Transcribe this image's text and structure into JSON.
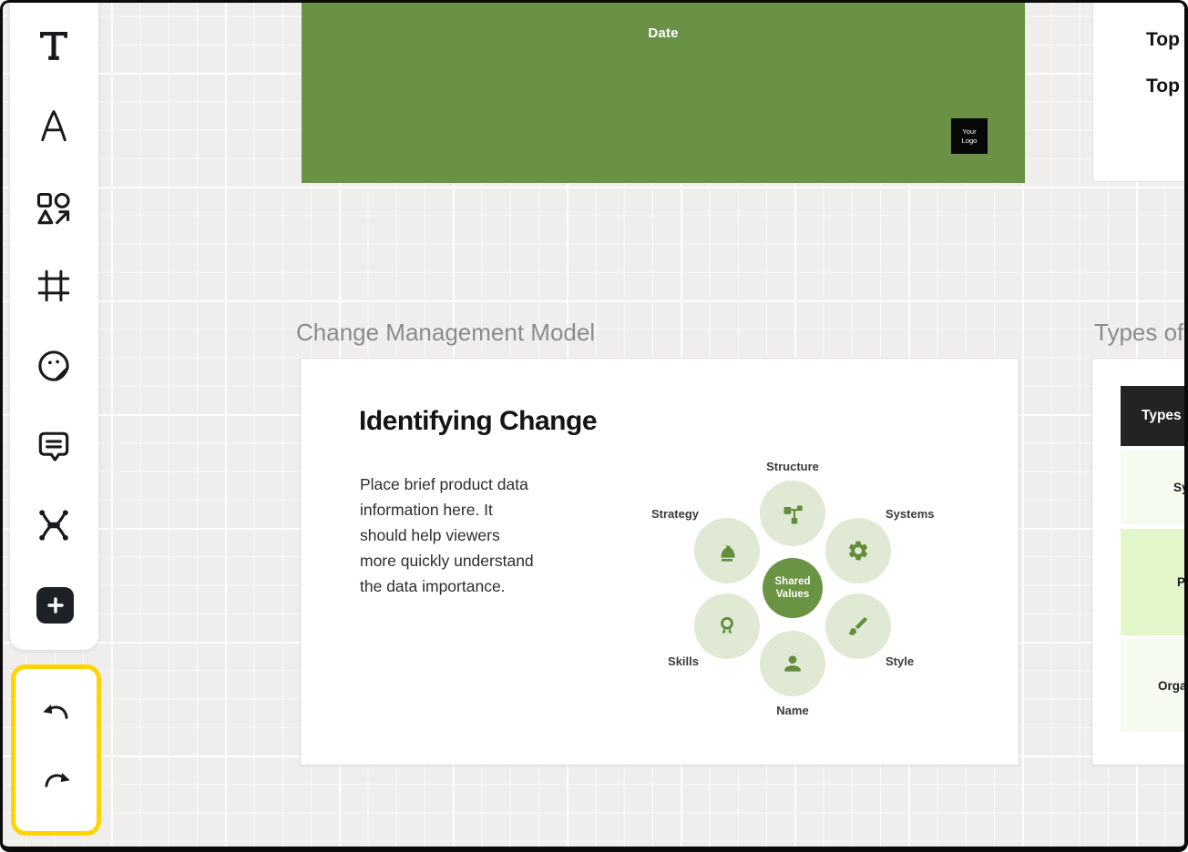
{
  "toolbar": {
    "tools": [
      {
        "name": "text-tool",
        "icon": "text-icon"
      },
      {
        "name": "lettering-tool",
        "icon": "letter-a-icon"
      },
      {
        "name": "shapes-tool",
        "icon": "shapes-icon"
      },
      {
        "name": "frame-tool",
        "icon": "frame-icon"
      },
      {
        "name": "sticker-tool",
        "icon": "sticker-icon"
      },
      {
        "name": "comment-tool",
        "icon": "comment-icon"
      },
      {
        "name": "connector-tool",
        "icon": "connector-icon"
      }
    ],
    "add_button_icon": "plus-icon"
  },
  "history_panel": {
    "undo_icon": "undo-icon",
    "redo_icon": "redo-icon",
    "highlight_color": "#fed402"
  },
  "banner": {
    "date_label": "Date",
    "logo_line1": "Your",
    "logo_line2": "Logo",
    "color": "#6b9146"
  },
  "slide1": {
    "section_title": "Change Management Model",
    "heading": "Identifying Change",
    "body_lines": [
      "Place brief product data",
      "information here. It",
      "should help viewers",
      "more quickly understand",
      "the data importance."
    ],
    "diagram": {
      "center_label": "Shared Values",
      "center_color": "#6b9344",
      "node_bg_color": "#dfe9d3",
      "icon_color": "#628c3c",
      "nodes": [
        {
          "label": "Structure",
          "icon": "sitemap-icon"
        },
        {
          "label": "Systems",
          "icon": "gear-icon"
        },
        {
          "label": "Style",
          "icon": "paintbrush-icon"
        },
        {
          "label": "Name",
          "icon": "person-icon"
        },
        {
          "label": "Skills",
          "icon": "award-icon"
        },
        {
          "label": "Strategy",
          "icon": "chess-knight-icon"
        }
      ]
    }
  },
  "slide2": {
    "section_title": "Types of",
    "table": {
      "header": "Types o",
      "header_bg": "#232323",
      "rows": [
        {
          "label": "Sys",
          "bg": "#f6fbf0"
        },
        {
          "label": "Pr",
          "bg": "#e3f6c9"
        },
        {
          "label": "Organ",
          "bg": "#f6fbf0"
        }
      ]
    }
  },
  "card_top_right": {
    "line1": "Top",
    "line2": "Top"
  }
}
